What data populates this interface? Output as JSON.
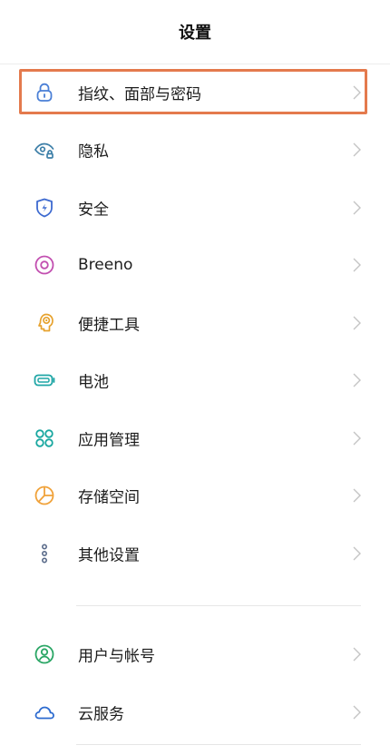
{
  "header": {
    "title": "设置"
  },
  "group1": [
    {
      "label": "指纹、面部与密码",
      "icon": "lock-icon",
      "highlighted": true
    },
    {
      "label": "隐私",
      "icon": "privacy-eye-icon"
    },
    {
      "label": "安全",
      "icon": "shield-icon"
    },
    {
      "label": "Breeno",
      "icon": "breeno-icon"
    },
    {
      "label": "便捷工具",
      "icon": "assistant-head-icon"
    },
    {
      "label": "电池",
      "icon": "battery-icon"
    },
    {
      "label": "应用管理",
      "icon": "apps-grid-icon"
    },
    {
      "label": "存储空间",
      "icon": "storage-pie-icon"
    },
    {
      "label": "其他设置",
      "icon": "more-dots-icon"
    }
  ],
  "group2": [
    {
      "label": "用户与帐号",
      "icon": "user-icon"
    },
    {
      "label": "云服务",
      "icon": "cloud-icon"
    }
  ],
  "colors": {
    "highlight": "#e47a4d",
    "lock": "#4a7fd6",
    "privacy": "#3d7fa8",
    "shield": "#3d6ad0",
    "breeno": "#c24fb0",
    "assistant": "#e6a22e",
    "battery": "#1fa6a6",
    "apps": "#19a7a0",
    "storage": "#f0a23a",
    "dots": "#5a6b8a",
    "user": "#2aa665",
    "cloud": "#2d6bd0"
  }
}
